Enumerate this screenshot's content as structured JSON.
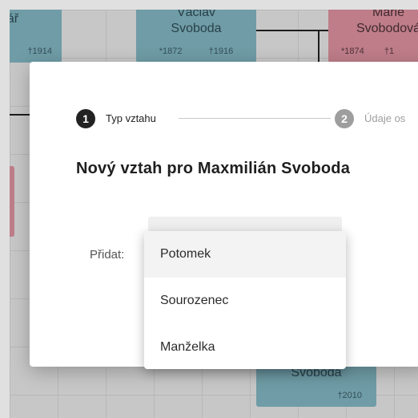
{
  "tree": {
    "cards": [
      {
        "name": "ovář",
        "dates": "†1914"
      },
      {
        "name": "Václav Svoboda",
        "birth": "*1872",
        "death": "†1916"
      },
      {
        "name": "Marie Svobodová",
        "birth": "*1874",
        "death": "†1"
      },
      {
        "name": "Svoboda",
        "dates": "†2010"
      }
    ]
  },
  "stepper": {
    "steps": [
      {
        "number": "1",
        "label": "Typ vztahu"
      },
      {
        "number": "2",
        "label": "Údaje os"
      }
    ]
  },
  "dialog": {
    "title": "Nový vztah pro Maxmilián Svoboda",
    "add_label": "Přidat:"
  },
  "relation_menu": {
    "options": [
      "Potomek",
      "Sourozenec",
      "Manželka"
    ]
  },
  "colors": {
    "male_card": "#7fb2be",
    "female_card": "#d98f9c",
    "step_active": "#222222",
    "step_inactive": "#9e9e9e"
  }
}
